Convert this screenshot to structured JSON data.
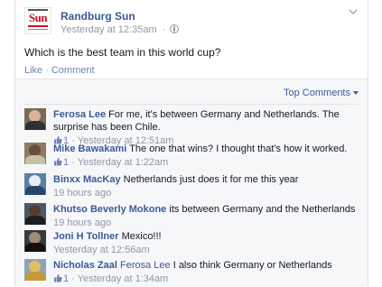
{
  "post": {
    "page_name": "Randburg Sun",
    "timestamp": "Yesterday at 12:35am",
    "audience_icon": "globe-icon",
    "text": "Which is the best team in this world cup?",
    "actions": {
      "like": "Like",
      "comment": "Comment"
    },
    "logo_text": "Sun"
  },
  "feedback": {
    "sort_label": "Top Comments",
    "comments": [
      {
        "author": "Ferosa Lee",
        "text": "For me, it's between Germany and Netherlands. The surprise has been Chile.",
        "likes": "1",
        "time": "Yesterday at 12:51am"
      },
      {
        "author": "Mike Bawakami",
        "text": "The one that wins? I thought that's how it worked.",
        "likes": "1",
        "time": "Yesterday at 1:22am"
      },
      {
        "author": "Binxx MacKay",
        "text": "Netherlands just does it for me this year",
        "likes": "",
        "time": "19 hours ago"
      },
      {
        "author": "Khutso Beverly Mokone",
        "text": "its between Germany and the Netherlands",
        "likes": "",
        "time": "19 hours ago"
      },
      {
        "author": "Joni H Tollner",
        "text": "Mexico!!!",
        "likes": "",
        "time": "Yesterday at 12:56am"
      },
      {
        "author": "Nicholas Zaal",
        "mention": "Ferosa Lee",
        "text": "I also think Germany or Netherlands",
        "likes": "1",
        "time": "Yesterday at 1:34am"
      }
    ]
  },
  "colors": {
    "link": "#3b5998",
    "meta": "#9197a3",
    "feedback_bg": "#f6f7f9",
    "logo_red": "#c8102e"
  }
}
